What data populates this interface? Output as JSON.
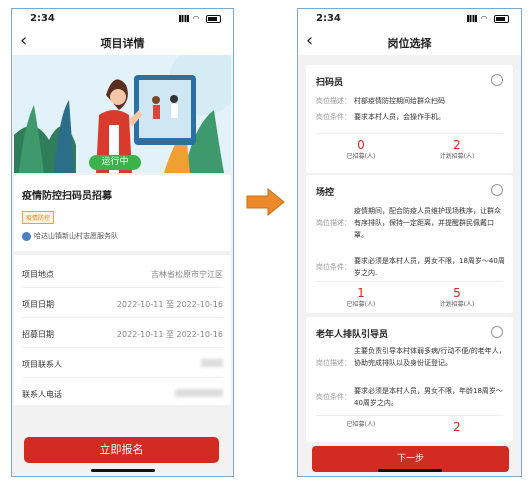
{
  "status": {
    "time": "2:34"
  },
  "left": {
    "nav_title": "项目详情",
    "badge": "运行中",
    "project_title": "疫情防控扫码员招募",
    "tag": "疫情防控",
    "team": "哈达山镇新山村志愿服务队",
    "details": [
      {
        "label": "项目地点",
        "value": "吉林省松原市宁江区"
      },
      {
        "label": "项目日期",
        "value": "2022-10-11 至 2022-10-16"
      },
      {
        "label": "招募日期",
        "value": "2022-10-11 至 2022-10-16"
      },
      {
        "label": "项目联系人",
        "value": ""
      },
      {
        "label": "联系人电话",
        "value": ""
      }
    ],
    "cta": "立即报名"
  },
  "right": {
    "nav_title": "岗位选择",
    "desc_label": "岗位描述：",
    "cond_label": "岗位条件：",
    "recruited_label": "已招募(人)",
    "planned_label": "计划招募(人)",
    "positions": [
      {
        "name": "扫码员",
        "desc": "村部疫情防控期间给群众扫码",
        "cond": "要求本村人员，会操作手机。",
        "recruited": "0",
        "planned": "2"
      },
      {
        "name": "场控",
        "desc": "疫情期间，配合防疫人员维护现场秩序，让群众有序排队，保持一定距离，并提醒群民佩戴口罩。",
        "cond": "要求必须是本村人员，男女不限，18周岁～40周岁之内.",
        "recruited": "1",
        "planned": "5"
      },
      {
        "name": "老年人排队引导员",
        "desc": "主要负责引导本村体弱多病/行动不便/的老年人，协助完成排队以及身份证登记。",
        "cond": "要求必须是本村人员，男女不限，年龄18周岁～40周岁之内。",
        "recruited": "",
        "planned": "2"
      }
    ],
    "next": "下一步"
  }
}
